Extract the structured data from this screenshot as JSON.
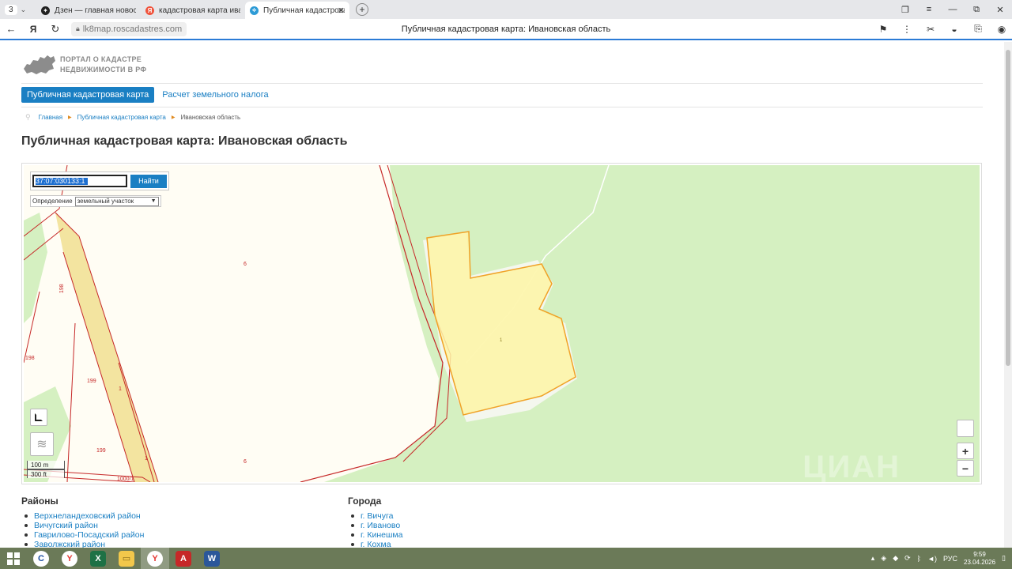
{
  "browser": {
    "tab_counter": "3",
    "tabs": [
      {
        "label": "Дзен — главная новостная",
        "icon_color": "#222222"
      },
      {
        "label": "кадастровая карта иванов",
        "icon_color": "#f0533c"
      },
      {
        "label": "Публичная кадастрова",
        "icon_color": "#2d9bd6"
      }
    ],
    "tab_close": "✕",
    "new_tab": "+",
    "url": "lk8map.roscadastres.com",
    "page_title": "Публичная кадастровая карта: Ивановская область"
  },
  "site": {
    "logo_line1": "ПОРТАЛ О КАДАСТРЕ",
    "logo_line2": "НЕДВИЖИМОСТИ В РФ",
    "menu": {
      "active": "Публичная кадастровая карта",
      "link": "Расчет земельного налога"
    },
    "breadcrumbs": [
      "Главная",
      "Публичная кадастровая карта",
      "Ивановская область"
    ],
    "heading": "Публичная кадастровая карта: Ивановская область"
  },
  "map": {
    "search_value": "37:07:030133:1",
    "search_button": "Найти",
    "definition_label": "Определение",
    "definition_value": "земельный участок",
    "zoom_in": "+",
    "zoom_out": "−",
    "scale_m": "100 m",
    "scale_ft": "300 ft",
    "labels": [
      "6",
      "198",
      "198",
      "199",
      "1",
      "199",
      "1",
      "6",
      "1000/1",
      "1"
    ],
    "watermark": "ЦИАН",
    "colors": {
      "forest": "#d5f0c1",
      "parcel_fill": "#fdf5a5",
      "parcel_stroke": "#f0a227",
      "boundary": "#c62828",
      "road": "#f3e4a0"
    }
  },
  "districts": {
    "title": "Районы",
    "items": [
      "Верхнеландеховский район",
      "Вичугский район",
      "Гаврилово-Посадский район",
      "Заволжский район"
    ]
  },
  "cities": {
    "title": "Города",
    "items": [
      "г. Вичуга",
      "г. Иваново",
      "г. Кинешма",
      "г. Кохма"
    ]
  },
  "taskbar": {
    "lang": "РУС",
    "time": "9:59",
    "date": "23.04.2026"
  }
}
